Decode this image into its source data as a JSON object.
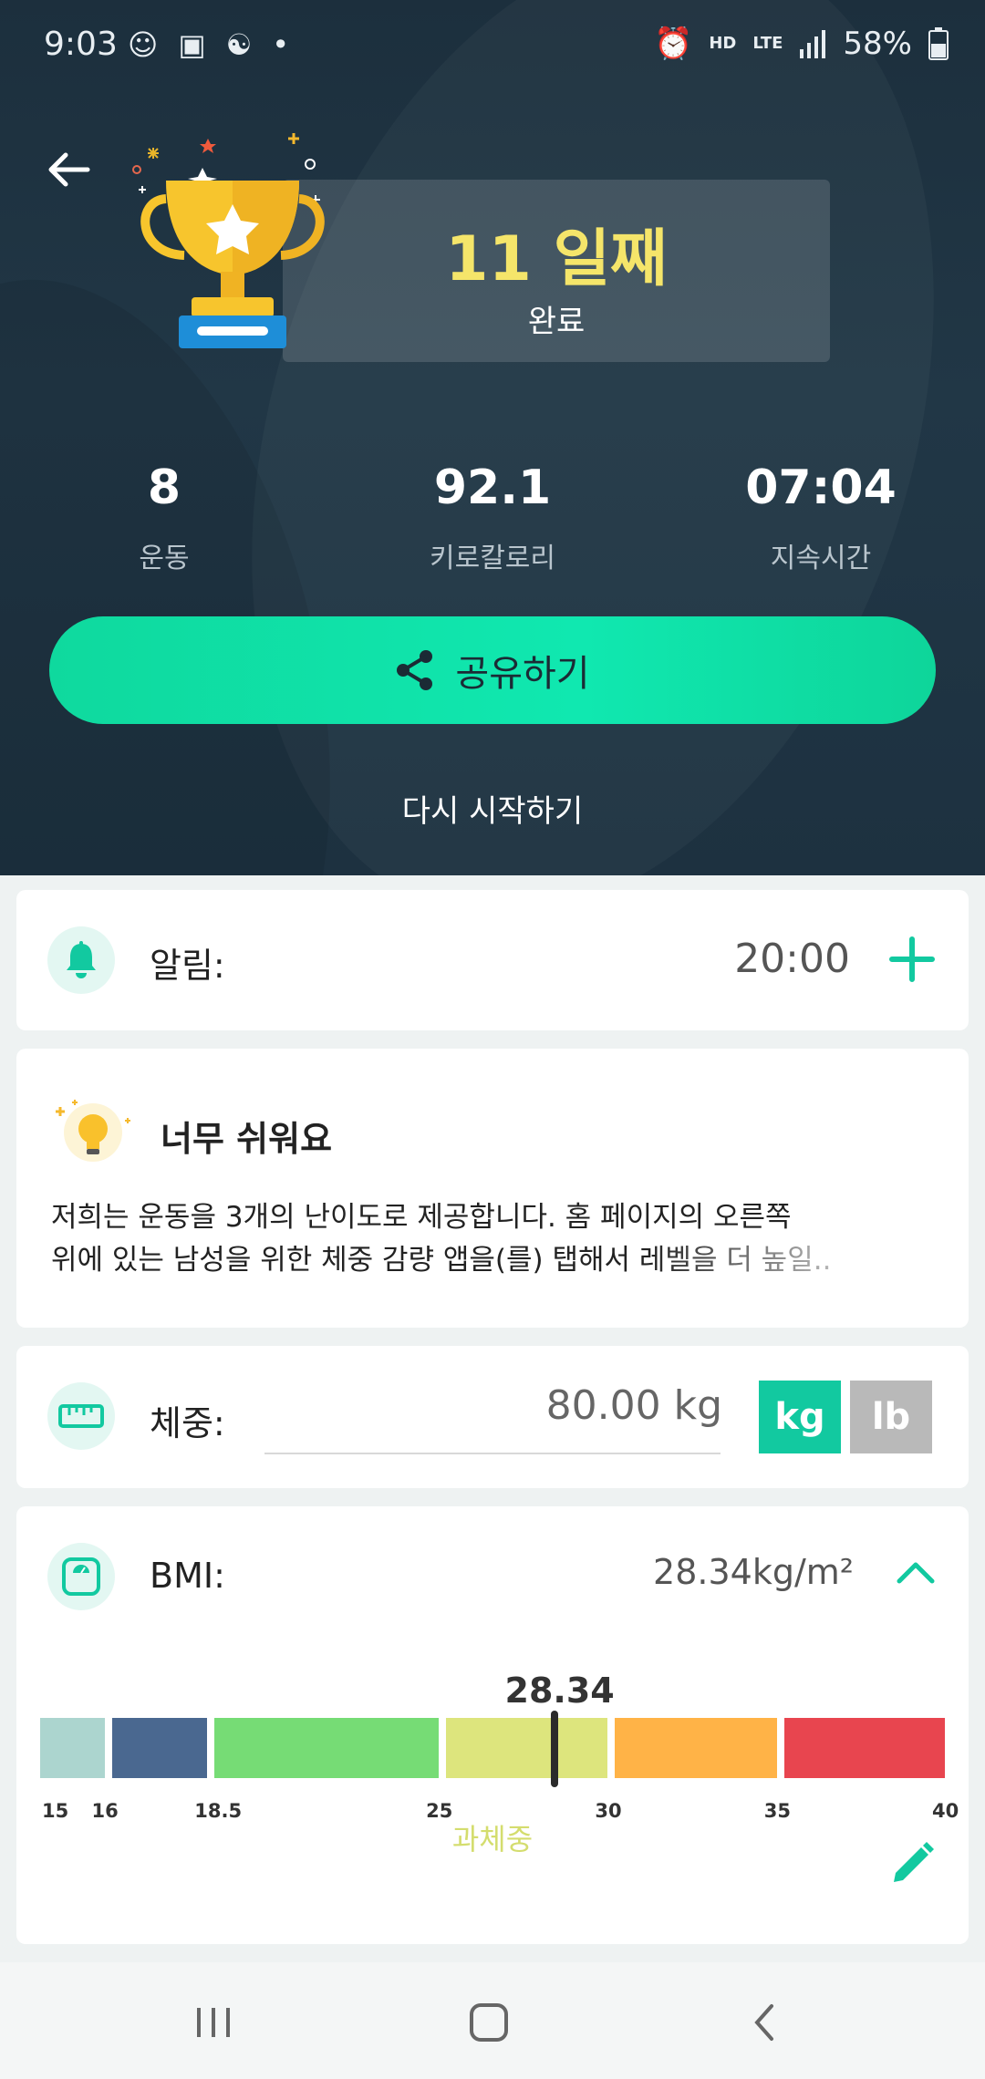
{
  "status_bar": {
    "time": "9:03",
    "battery": "58%",
    "hd": "HD",
    "lte": "LTE"
  },
  "hero": {
    "day_count": "11 일째",
    "completed_label": "완료",
    "stats": [
      {
        "value": "8",
        "label": "운동"
      },
      {
        "value": "92.1",
        "label": "키로칼로리"
      },
      {
        "value": "07:04",
        "label": "지속시간"
      }
    ],
    "share_label": "공유하기",
    "restart_label": "다시 시작하기"
  },
  "reminder": {
    "label": "알림:",
    "time": "20:00"
  },
  "tip": {
    "title": "너무 쉬워요",
    "line1": "저희는 운동을 3개의 난이도로 제공합니다. 홈 페이지의 오른쪽",
    "line2": "위에 있는 남성을 위한 체중 감량 앱을(를) 탭해서 레벨을 더 높일.."
  },
  "weight": {
    "label": "체중:",
    "value": "80.00 kg",
    "unit_kg": "kg",
    "unit_lb": "lb"
  },
  "bmi": {
    "label": "BMI:",
    "value_text": "28.34kg/m²",
    "marker_label": "28.34",
    "marker_value": 28.34,
    "category": "과체중",
    "scale_min": 15,
    "scale_max": 40,
    "segments": [
      {
        "from": 15,
        "to": 16,
        "color": "#acd5cf"
      },
      {
        "from": 16,
        "to": 18.5,
        "color": "#4a6890"
      },
      {
        "from": 18.5,
        "to": 25,
        "color": "#76dc75"
      },
      {
        "from": 25,
        "to": 30,
        "color": "#dde57d"
      },
      {
        "from": 30,
        "to": 35,
        "color": "#ffb347"
      },
      {
        "from": 35,
        "to": 40,
        "color": "#e8454f"
      }
    ],
    "ticks": [
      "15",
      "16",
      "18.5",
      "25",
      "30",
      "35",
      "40"
    ]
  },
  "colors": {
    "accent": "#12c9a0",
    "share_button": "#10e8b0",
    "gold_text": "#f5e56a",
    "unit_inactive": "#b9b9b9"
  }
}
